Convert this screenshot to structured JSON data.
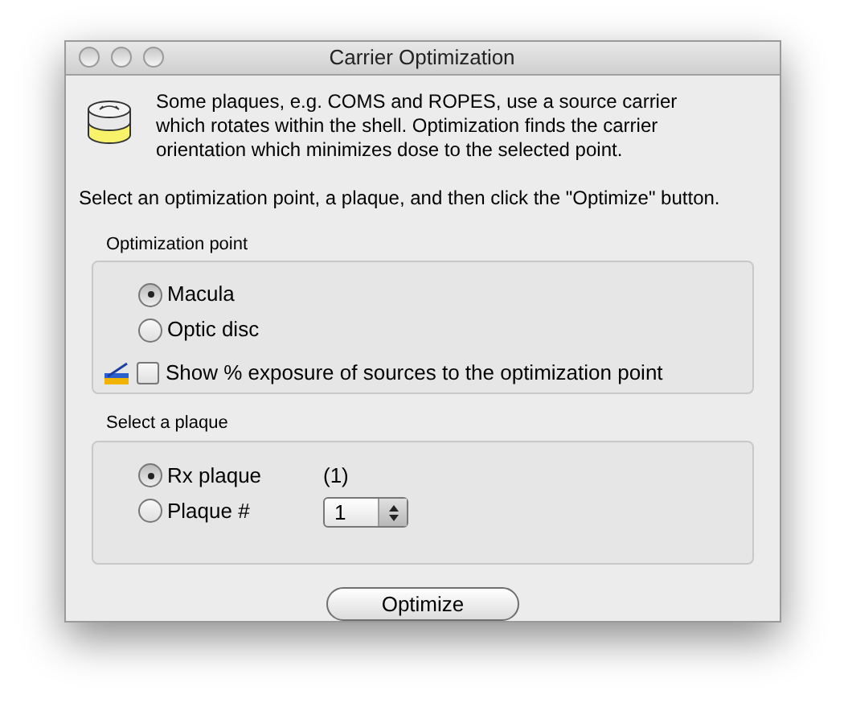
{
  "window": {
    "title": "Carrier Optimization"
  },
  "intro": "Some plaques, e.g. COMS and ROPES, use a source carrier which rotates within the shell. Optimization finds the carrier orientation which minimizes dose to the selected point.",
  "instruction": "Select an optimization point, a plaque, and then click the \"Optimize\" button.",
  "optimization_point": {
    "label": "Optimization point",
    "options": [
      {
        "label": "Macula",
        "selected": true
      },
      {
        "label": "Optic disc",
        "selected": false
      }
    ],
    "show_exposure": {
      "label": "Show % exposure of sources to the optimization point",
      "checked": false
    }
  },
  "plaque": {
    "label": "Select a plaque",
    "options": [
      {
        "label": "Rx plaque",
        "selected": true,
        "kind": "note",
        "note": "(1)"
      },
      {
        "label": "Plaque #",
        "selected": false,
        "kind": "stepper",
        "value": "1"
      }
    ]
  },
  "buttons": [
    "Optimize"
  ]
}
